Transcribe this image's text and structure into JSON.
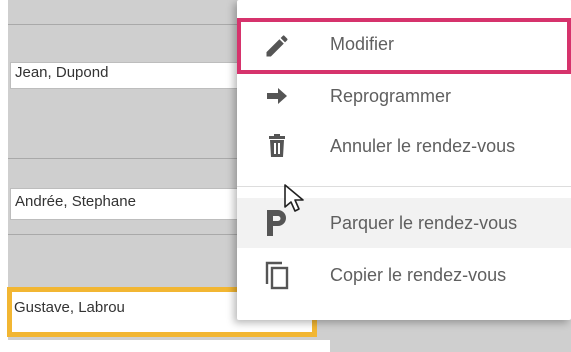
{
  "appointments": [
    {
      "name": "Jean, Dupond"
    },
    {
      "name": "Andrée, Stephane"
    },
    {
      "name": "Gustave, Labrou"
    }
  ],
  "context_menu": {
    "items": [
      {
        "label": "Modifier",
        "icon": "pencil-icon"
      },
      {
        "label": "Reprogrammer",
        "icon": "arrow-right-icon"
      },
      {
        "label": "Annuler le rendez-vous",
        "icon": "trash-icon"
      },
      {
        "label": "Parquer le rendez-vous",
        "icon": "parking-p-icon"
      },
      {
        "label": "Copier le rendez-vous",
        "icon": "copy-icon"
      }
    ]
  },
  "colors": {
    "highlight_border": "#d6336c",
    "selected_appointment_border": "#f2b632",
    "menu_text": "#5f5f5f",
    "icon_color": "#555555",
    "calendar_gray": "#cfcfcf"
  }
}
